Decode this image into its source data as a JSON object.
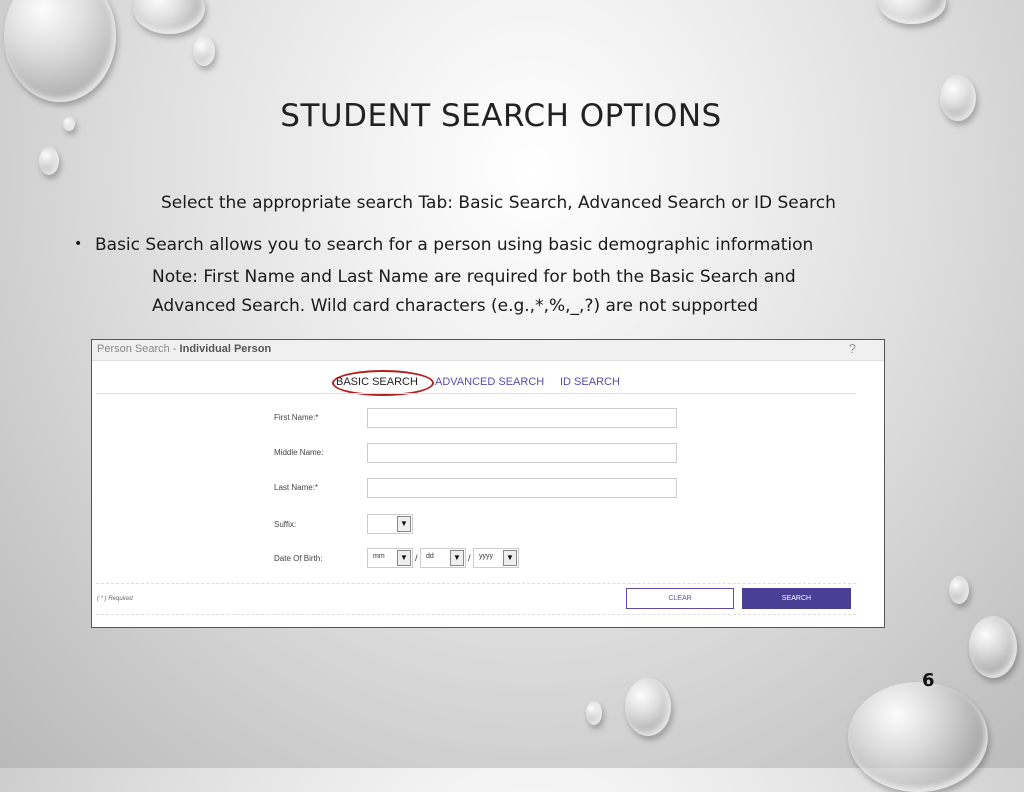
{
  "slide": {
    "title": "STUDENT SEARCH OPTIONS",
    "intro": "Select the appropriate search Tab: Basic Search, Advanced Search or ID Search",
    "bullet": "Basic Search allows you to search for a person using basic demographic information",
    "note_line1": "Note: First Name and Last Name are required for both the Basic Search and",
    "note_line2": "Advanced Search. Wild card characters (e.g.,*,%,_,?) are not supported",
    "page_number": "6"
  },
  "panel": {
    "title_prefix": "Person Search - ",
    "title_bold": "Individual Person",
    "help": "?",
    "tabs": [
      "BASIC SEARCH",
      "ADVANCED SEARCH",
      "ID SEARCH"
    ],
    "fields": {
      "first_name": "First Name:*",
      "middle_name": "Middle Name:",
      "last_name": "Last Name:*",
      "suffix": "Suffix:",
      "dob": "Date Of Birth:"
    },
    "dob_month": "mm",
    "dob_day": "dd",
    "dob_year": "yyyy",
    "separator": "/",
    "required_note": "( * ) Required",
    "clear_label": "CLEAR",
    "search_label": "SEARCH"
  },
  "colors": {
    "accent": "#4b3e97",
    "tab_link": "#5a4bb0",
    "highlight_ring": "#b02020"
  }
}
